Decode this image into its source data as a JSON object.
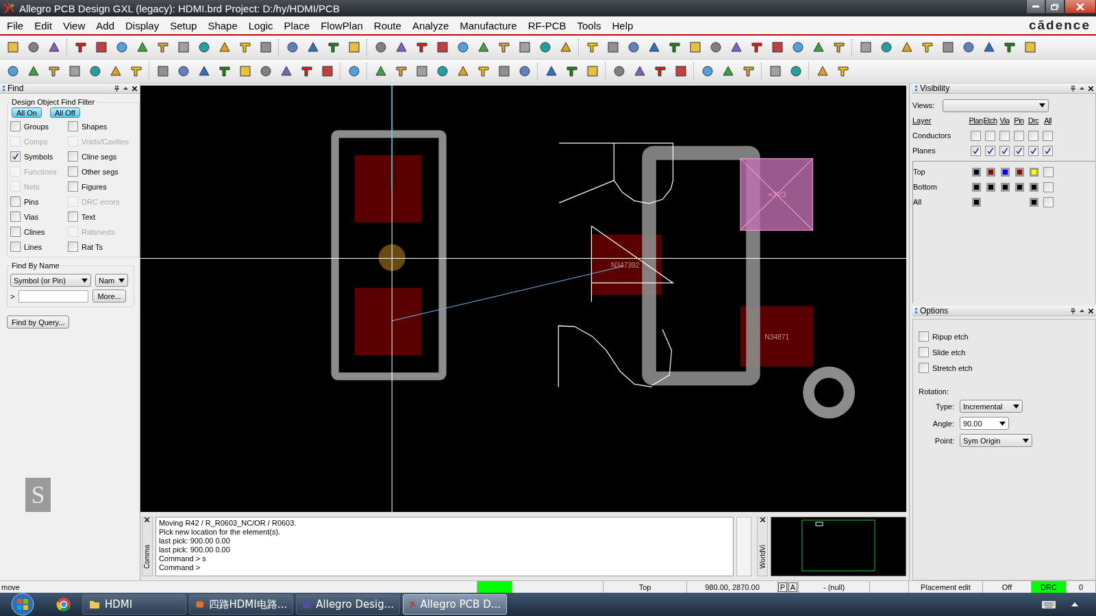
{
  "window": {
    "title": "Allegro PCB Design GXL (legacy): HDMI.brd  Project: D:/hy/HDMI/PCB"
  },
  "menu": [
    "File",
    "Edit",
    "View",
    "Add",
    "Display",
    "Setup",
    "Shape",
    "Logic",
    "Place",
    "FlowPlan",
    "Route",
    "Analyze",
    "Manufacture",
    "RF-PCB",
    "Tools",
    "Help"
  ],
  "brand": "cādence",
  "find_panel": {
    "title": "Find",
    "filter_title": "Design Object Find Filter",
    "buttons": [
      "All On",
      "All Off"
    ],
    "filters": [
      {
        "label": "Groups",
        "checked": false,
        "disabled": false
      },
      {
        "label": "Shapes",
        "checked": false,
        "disabled": false
      },
      {
        "label": "Comps",
        "checked": false,
        "disabled": true
      },
      {
        "label": "Voids/Cavities",
        "checked": false,
        "disabled": true
      },
      {
        "label": "Symbols",
        "checked": true,
        "disabled": false
      },
      {
        "label": "Cline segs",
        "checked": false,
        "disabled": false
      },
      {
        "label": "Functions",
        "checked": false,
        "disabled": true
      },
      {
        "label": "Other segs",
        "checked": false,
        "disabled": false
      },
      {
        "label": "Nets",
        "checked": false,
        "disabled": true
      },
      {
        "label": "Figures",
        "checked": false,
        "disabled": false
      },
      {
        "label": "Pins",
        "checked": false,
        "disabled": false
      },
      {
        "label": "DRC errors",
        "checked": false,
        "disabled": true
      },
      {
        "label": "Vias",
        "checked": false,
        "disabled": false
      },
      {
        "label": "Text",
        "checked": false,
        "disabled": false
      },
      {
        "label": "Clines",
        "checked": false,
        "disabled": false
      },
      {
        "label": "Ratsnests",
        "checked": false,
        "disabled": true
      },
      {
        "label": "Lines",
        "checked": false,
        "disabled": false
      },
      {
        "label": "Rat Ts",
        "checked": false,
        "disabled": false
      }
    ],
    "by_name_title": "Find By Name",
    "object_type": "Symbol (or Pin)",
    "field_type": "Nam",
    "prompt": ">",
    "more_button": "More...",
    "query_button": "Find by Query..."
  },
  "side_badge": "S",
  "canvas": {
    "labels": [
      {
        "text": "+3V3"
      },
      {
        "text": "N347392"
      },
      {
        "text": "N34871"
      }
    ]
  },
  "command_window": {
    "side_label": "Comma",
    "lines": [
      "Moving R42 / R_R0603_NC/OR / R0603.",
      "Pick new location for the element(s).",
      "last pick:  900.00 0.00",
      "last pick:  900.00 0.00",
      "Command > s",
      "Command >"
    ]
  },
  "world_view": {
    "side_label": "WorldVi"
  },
  "visibility": {
    "title": "Visibility",
    "views_label": "Views:",
    "columns": [
      "Layer",
      "Plan",
      "Etch",
      "Via",
      "Pin",
      "Drc",
      "All"
    ],
    "rows": [
      {
        "label": "Conductors",
        "cells": [
          {
            "kind": "box",
            "checked": false
          },
          {
            "kind": "box",
            "checked": false
          },
          {
            "kind": "box",
            "checked": false
          },
          {
            "kind": "box",
            "checked": false
          },
          {
            "kind": "box",
            "checked": false
          },
          {
            "kind": "box",
            "checked": false
          }
        ]
      },
      {
        "label": "Planes",
        "cells": [
          {
            "kind": "box",
            "checked": true
          },
          {
            "kind": "box",
            "checked": true
          },
          {
            "kind": "box",
            "checked": true
          },
          {
            "kind": "box",
            "checked": true
          },
          {
            "kind": "box",
            "checked": true
          },
          {
            "kind": "box",
            "checked": true
          }
        ]
      }
    ],
    "layers": [
      {
        "label": "Top",
        "cells": [
          {
            "kind": "swatch",
            "color": "#000000"
          },
          {
            "kind": "swatch",
            "color": "#a00000"
          },
          {
            "kind": "swatch",
            "color": "#0000ff"
          },
          {
            "kind": "swatch",
            "color": "#a00000"
          },
          {
            "kind": "swatch",
            "color": "#ffff00"
          },
          {
            "kind": "box",
            "checked": false
          }
        ]
      },
      {
        "label": "Bottom",
        "cells": [
          {
            "kind": "swatch",
            "color": "#000000"
          },
          {
            "kind": "swatch",
            "color": "#000000"
          },
          {
            "kind": "swatch",
            "color": "#000000"
          },
          {
            "kind": "swatch",
            "color": "#000000"
          },
          {
            "kind": "swatch",
            "color": "#000000"
          },
          {
            "kind": "box",
            "checked": false
          }
        ]
      },
      {
        "label": "All",
        "cells": [
          {
            "kind": "swatch",
            "color": "#000000"
          },
          {
            "kind": "empty"
          },
          {
            "kind": "empty"
          },
          {
            "kind": "empty"
          },
          {
            "kind": "swatch",
            "color": "#000000"
          },
          {
            "kind": "box",
            "checked": false
          }
        ]
      }
    ]
  },
  "options": {
    "title": "Options",
    "checks": [
      {
        "label": "Ripup etch",
        "checked": false
      },
      {
        "label": "Slide etch",
        "checked": false
      },
      {
        "label": "Stretch etch",
        "checked": false
      }
    ],
    "rotation_label": "Rotation:",
    "fields": [
      {
        "label": "Type:",
        "value": "Incremental"
      },
      {
        "label": "Angle:",
        "value": "90.00"
      },
      {
        "label": "Point:",
        "value": "Sym Origin"
      }
    ]
  },
  "status_bar": {
    "mode": "move",
    "fields": [
      {
        "kind": "indicator",
        "color": "#00ff00"
      },
      {
        "kind": "text"
      },
      {
        "kind": "text",
        "text": "Top"
      },
      {
        "kind": "text",
        "text": "980.00, 2870.00"
      },
      {
        "kind": "key",
        "text": "P"
      },
      {
        "kind": "key",
        "text": "A"
      },
      {
        "kind": "text",
        "text": "- (null)"
      },
      {
        "kind": "text"
      },
      {
        "kind": "text",
        "text": "Placement edit"
      },
      {
        "kind": "text",
        "text": "Off"
      },
      {
        "kind": "indicator",
        "color": "#00ff00",
        "text": "DRC"
      },
      {
        "kind": "text",
        "text": "0"
      }
    ]
  },
  "taskbar": {
    "items": [
      {
        "label": "HDMI",
        "selected": false
      },
      {
        "label": "四路HDMI电路...",
        "selected": false
      },
      {
        "label": "Allegro Desig...",
        "selected": false
      },
      {
        "label": "Allegro PCB D...",
        "selected": true
      }
    ]
  }
}
